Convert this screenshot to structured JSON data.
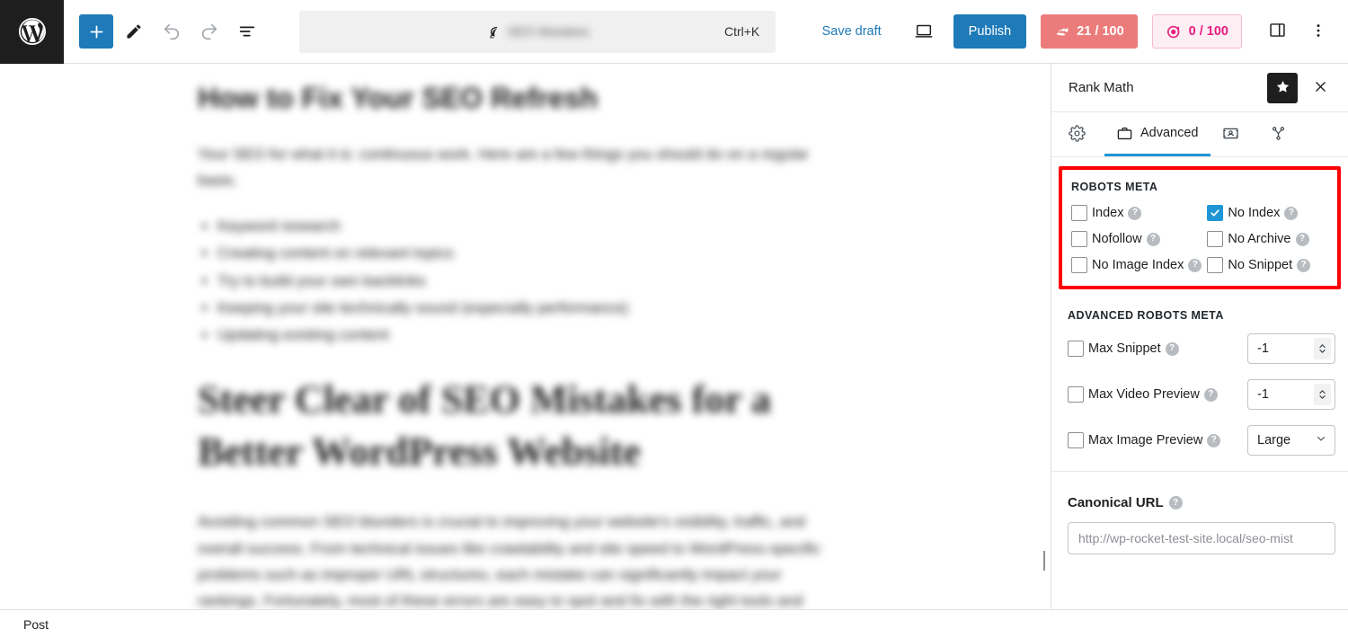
{
  "topbar": {
    "logo_icon": "wordpress-logo-icon",
    "add_block_icon": "plus-icon",
    "edit_icon": "pencil-icon",
    "undo_icon": "undo-arrow-icon",
    "redo_icon": "redo-arrow-icon",
    "list_view_icon": "document-outline-icon",
    "document_bar": {
      "leaf_icon": "rank-math-leaf-icon",
      "title": "SEO Mistakes",
      "shortcut": "Ctrl+K"
    },
    "save_draft_label": "Save draft",
    "preview_icon": "preview-monitor-icon",
    "publish_label": "Publish",
    "seo_badge": {
      "icon": "rank-math-seo-icon",
      "value": "21 / 100",
      "bg": "#ec7c7c",
      "fg": "#ffffff"
    },
    "pink_badge": {
      "icon": "content-ai-target-icon",
      "value": "0 / 100",
      "bg": "#fdeef4",
      "fg": "#e91e7f",
      "border": "#f5b9d4"
    },
    "sidebar_toggle_icon": "settings-sidebar-icon",
    "more_options_icon": "vertical-dots-icon"
  },
  "editor": {
    "post_title": "How to Fix Your SEO Refresh",
    "intro_paragraph": "Your SEO for what it is: continuous work. Here are a few things you should do on a regular basis.",
    "list_items": [
      "Keyword research",
      "Creating content on relevant topics",
      "Try to build your own backlinks",
      "Keeping your site technically sound (especially performance)",
      "Updating existing content"
    ],
    "heading_2": "Steer Clear of SEO Mistakes for a Better WordPress Website",
    "body_paragraph": "Avoiding common SEO blunders is crucial to improving your website's visibility, traffic, and overall success. From technical issues like crawlability and site speed to WordPress-specific problems such as improper URL structures, each mistake can significantly impact your rankings. Fortunately, most of these errors are easy to spot and fix with the right tools and techniques."
  },
  "panel": {
    "title": "Rank Math",
    "star_icon": "star-icon",
    "close_icon": "close-x-icon",
    "tabs": [
      {
        "id": "general",
        "label": "",
        "icon": "gear-icon",
        "active": false
      },
      {
        "id": "advanced",
        "label": "Advanced",
        "icon": "briefcase-icon",
        "active": true
      },
      {
        "id": "social",
        "label": "",
        "icon": "social-card-icon",
        "active": false
      },
      {
        "id": "schema",
        "label": "",
        "icon": "schema-share-icon",
        "active": false
      }
    ],
    "robots_meta": {
      "section_title": "ROBOTS META",
      "highlight_color": "#ff0000",
      "checked_color": "#2196d6",
      "options": [
        {
          "label": "Index",
          "checked": false,
          "help_icon": "help-circle-icon"
        },
        {
          "label": "No Index",
          "checked": true,
          "help_icon": "help-circle-icon"
        },
        {
          "label": "Nofollow",
          "checked": false,
          "help_icon": "help-circle-icon"
        },
        {
          "label": "No Archive",
          "checked": false,
          "help_icon": "help-circle-icon"
        },
        {
          "label": "No Image Index",
          "checked": false,
          "help_icon": "help-circle-icon"
        },
        {
          "label": "No Snippet",
          "checked": false,
          "help_icon": "help-circle-icon"
        }
      ]
    },
    "advanced_robots_meta": {
      "section_title": "ADVANCED ROBOTS META",
      "rows": [
        {
          "label": "Max Snippet",
          "checked": false,
          "control": "number",
          "value": "-1",
          "help_icon": "help-circle-icon",
          "spinner_icon": "spinner-up-down-icon"
        },
        {
          "label": "Max Video Preview",
          "checked": false,
          "control": "number",
          "value": "-1",
          "help_icon": "help-circle-icon",
          "spinner_icon": "spinner-up-down-icon"
        },
        {
          "label": "Max Image Preview",
          "checked": false,
          "control": "select",
          "value": "Large",
          "help_icon": "help-circle-icon",
          "chevron_icon": "chevron-down-icon"
        }
      ]
    },
    "canonical": {
      "label": "Canonical URL",
      "help_icon": "help-circle-icon",
      "placeholder": "http://wp-rocket-test-site.local/seo-mist",
      "value": ""
    }
  },
  "footer": {
    "block_type": "Post"
  }
}
